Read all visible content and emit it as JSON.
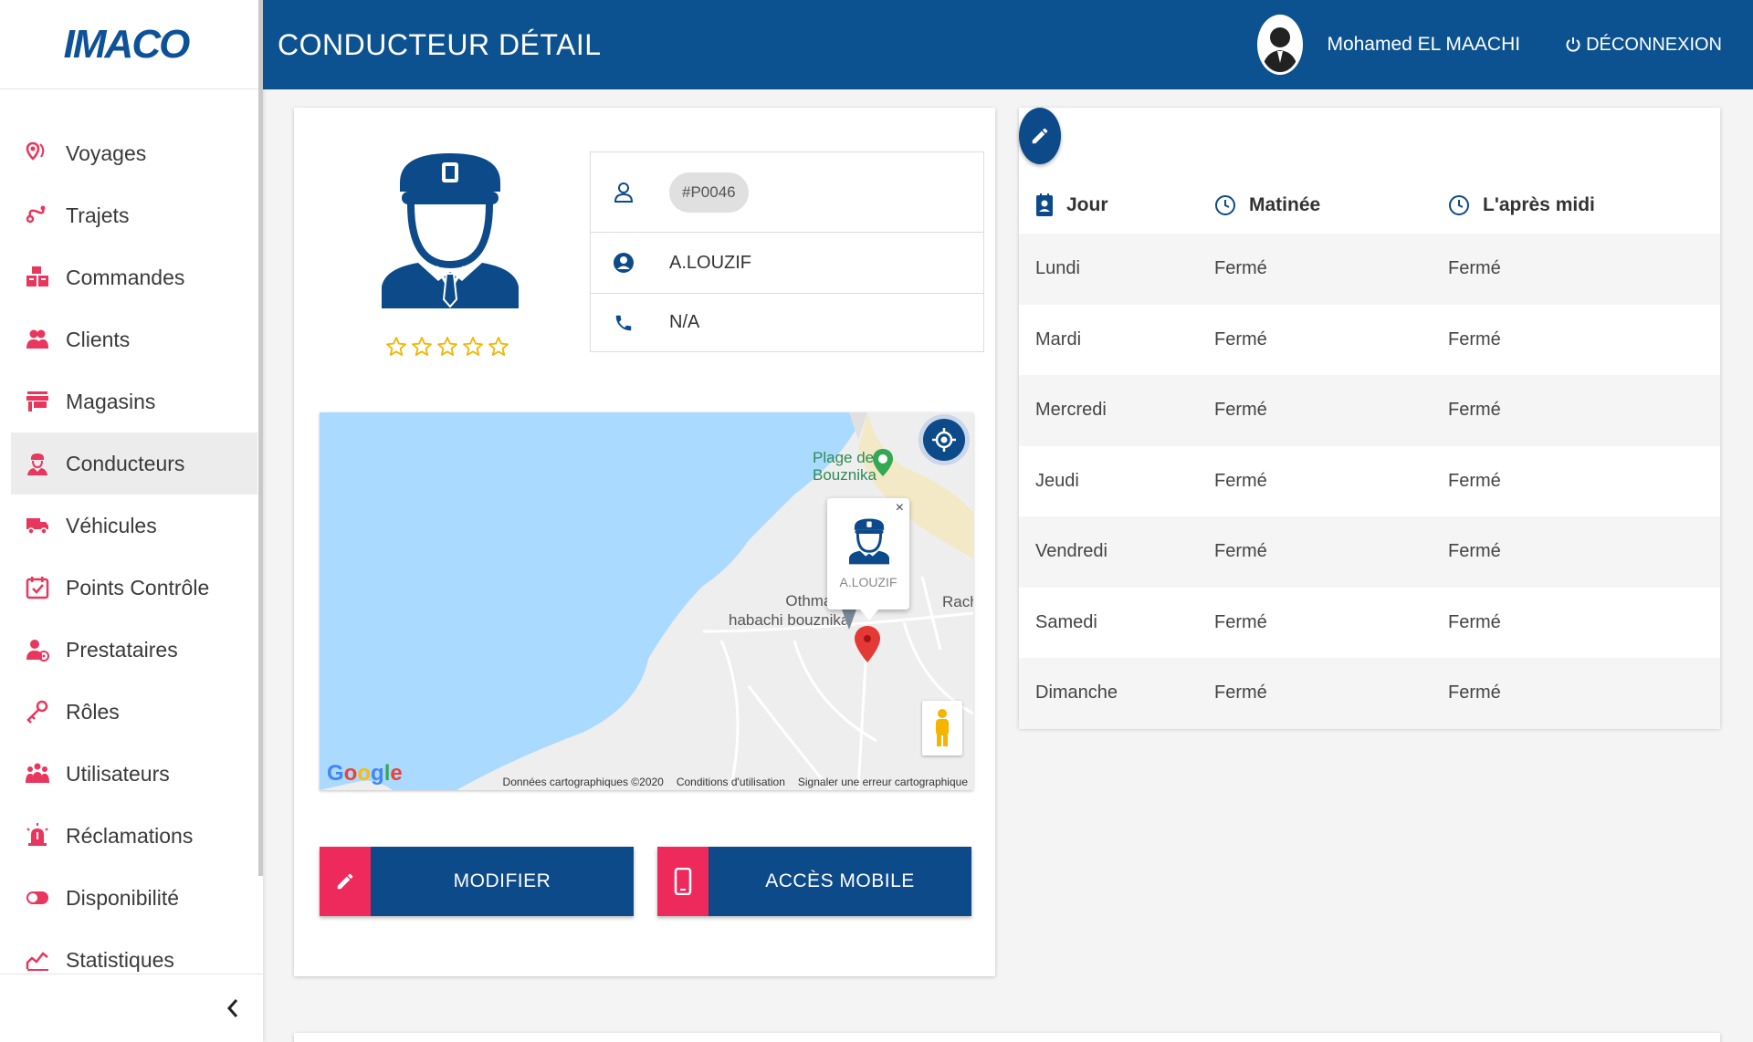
{
  "app": {
    "logo": "IMACO",
    "page_title": "CONDUCTEUR DÉTAIL"
  },
  "header": {
    "user_name": "Mohamed EL MAACHI",
    "logout_label": "DÉCONNEXION"
  },
  "sidebar": {
    "items": [
      {
        "label": "Voyages",
        "icon": "voyages-icon"
      },
      {
        "label": "Trajets",
        "icon": "route-icon"
      },
      {
        "label": "Commandes",
        "icon": "boxes-icon"
      },
      {
        "label": "Clients",
        "icon": "clients-icon"
      },
      {
        "label": "Magasins",
        "icon": "store-icon"
      },
      {
        "label": "Conducteurs",
        "icon": "driver-icon",
        "active": true
      },
      {
        "label": "Véhicules",
        "icon": "truck-icon"
      },
      {
        "label": "Points Contrôle",
        "icon": "calendar-check-icon"
      },
      {
        "label": "Prestataires",
        "icon": "provider-icon"
      },
      {
        "label": "Rôles",
        "icon": "key-icon"
      },
      {
        "label": "Utilisateurs",
        "icon": "users-icon"
      },
      {
        "label": "Réclamations",
        "icon": "alarm-icon"
      },
      {
        "label": "Disponibilité",
        "icon": "toggle-icon"
      },
      {
        "label": "Statistiques",
        "icon": "stats-icon"
      }
    ]
  },
  "driver": {
    "code": "#P0046",
    "name": "A.LOUZIF",
    "phone": "N/A",
    "rating": 0
  },
  "map": {
    "labels": {
      "beach": "Plage de\nBouznika",
      "place": "Othmane\nhabachi bouznika",
      "rach": "Rach"
    },
    "infowindow_name": "A.LOUZIF",
    "footer": {
      "data": "Données cartographiques ©2020",
      "terms": "Conditions d'utilisation",
      "report": "Signaler une erreur cartographique"
    }
  },
  "actions": {
    "modify": "MODIFIER",
    "mobile": "ACCÈS MOBILE"
  },
  "schedule": {
    "headers": {
      "day": "Jour",
      "morning": "Matinée",
      "afternoon": "L'après midi"
    },
    "rows": [
      {
        "day": "Lundi",
        "morning": "Fermé",
        "afternoon": "Fermé"
      },
      {
        "day": "Mardi",
        "morning": "Fermé",
        "afternoon": "Fermé"
      },
      {
        "day": "Mercredi",
        "morning": "Fermé",
        "afternoon": "Fermé"
      },
      {
        "day": "Jeudi",
        "morning": "Fermé",
        "afternoon": "Fermé"
      },
      {
        "day": "Vendredi",
        "morning": "Fermé",
        "afternoon": "Fermé"
      },
      {
        "day": "Samedi",
        "morning": "Fermé",
        "afternoon": "Fermé"
      },
      {
        "day": "Dimanche",
        "morning": "Fermé",
        "afternoon": "Fermé"
      }
    ]
  },
  "colors": {
    "primary": "#0d5290",
    "accent": "#ee2a5d",
    "star": "#f5b400"
  }
}
